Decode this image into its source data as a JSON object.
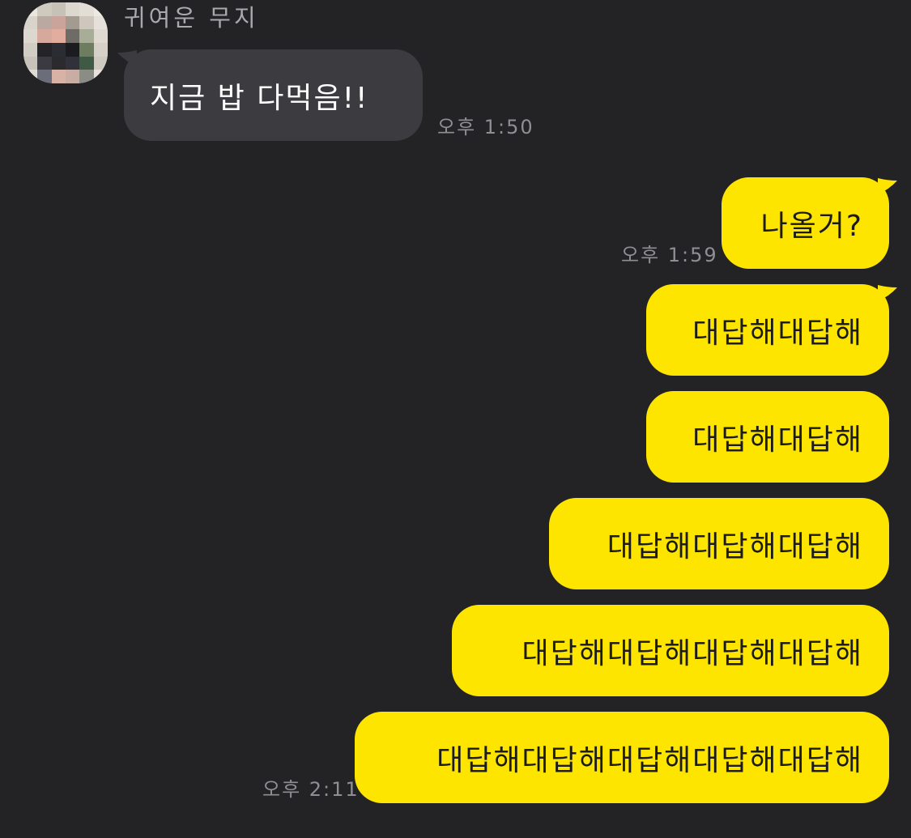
{
  "chat": {
    "sender_name": "귀여운 무지",
    "incoming": [
      {
        "text": "지금 밥 다먹음!!",
        "time": "오후 1:50"
      }
    ],
    "outgoing": [
      {
        "text": "나올거?",
        "time": "오후 1:59"
      },
      {
        "text": "대답해대답해"
      },
      {
        "text": "대답해대답해"
      },
      {
        "text": "대답해대답해대답해"
      },
      {
        "text": "대답해대답해대답해대답해"
      },
      {
        "text": "대답해대답해대답해대답해대답해",
        "time": "오후 2:11"
      }
    ]
  },
  "colors": {
    "background": "#232326",
    "incoming_bubble": "#3c3c40",
    "outgoing_bubble": "#fee500",
    "time_text": "#8f8f93"
  },
  "icons": {
    "avatar": "pixelated-profile-picture"
  }
}
